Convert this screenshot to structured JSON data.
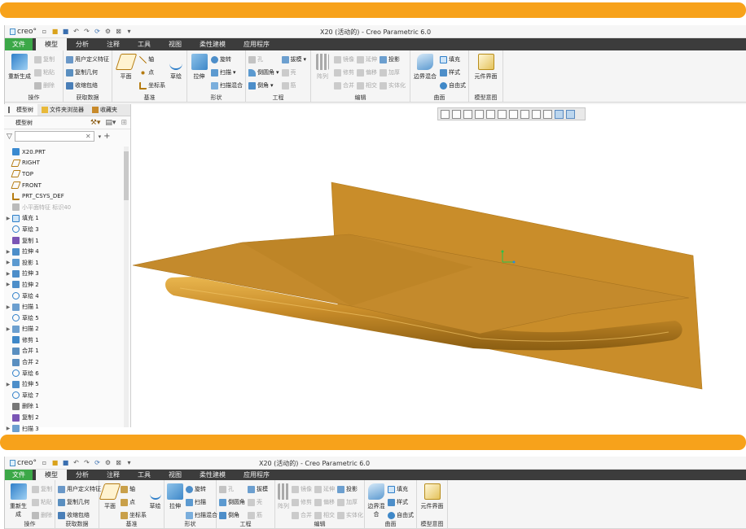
{
  "window": {
    "logo": "creo°",
    "title": "X20 (活动的) - Creo Parametric 6.0"
  },
  "menu": {
    "file": "文件",
    "tabs": [
      "模型",
      "分析",
      "注释",
      "工具",
      "视图",
      "柔性建模",
      "应用程序"
    ]
  },
  "ribbon": {
    "operations": {
      "label": "操作",
      "regen": "重新生成",
      "copy": "复制",
      "paste": "粘贴",
      "delete": "删除"
    },
    "get_data": {
      "label": "获取数据",
      "udf": "用户定义特征",
      "copy_geom": "复制几何",
      "shrinkwrap": "收缩包络"
    },
    "datum": {
      "label": "基准",
      "plane": "平面",
      "axis": "轴",
      "point": "点",
      "csys": "坐标系",
      "sketch": "草绘"
    },
    "shapes": {
      "label": "形状",
      "extrude": "拉伸",
      "revolve": "旋转",
      "sweep": "扫描",
      "swept_blend": "扫描混合"
    },
    "engineering": {
      "label": "工程",
      "hole": "孔",
      "round": "倒圆角",
      "chamfer": "倒角",
      "draft": "拔模",
      "shell": "壳",
      "rib": "筋"
    },
    "editing": {
      "label": "编辑",
      "pattern": "阵列",
      "mirror": "镜像",
      "extend": "延伸",
      "project": "投影",
      "trim": "修剪",
      "offset": "偏移",
      "thicken": "加厚",
      "merge": "合并",
      "intersect": "相交",
      "solidify": "实体化"
    },
    "surfaces": {
      "label": "曲面",
      "boundary_blend": "边界混合",
      "fill": "填充",
      "style": "样式",
      "freestyle": "自由式"
    },
    "model_intent": {
      "label": "模型意图",
      "component_interface": "元件界面"
    }
  },
  "left_panel": {
    "tabs": [
      "模型树",
      "文件夹浏览器",
      "收藏夹"
    ],
    "header": "模型树",
    "filter_placeholder": "",
    "tree": [
      {
        "label": "X20.PRT",
        "icon": "part-icon",
        "expand": ""
      },
      {
        "label": "RIGHT",
        "icon": "datum-plane-icon",
        "expand": ""
      },
      {
        "label": "TOP",
        "icon": "datum-plane-icon",
        "expand": ""
      },
      {
        "label": "FRONT",
        "icon": "datum-plane-icon",
        "expand": ""
      },
      {
        "label": "PRT_CSYS_DEF",
        "icon": "csys-icon",
        "expand": ""
      },
      {
        "label": "小平面特征 标识40",
        "icon": "facet-icon",
        "expand": "",
        "dim": true
      },
      {
        "label": "填充 1",
        "icon": "fill-icon",
        "expand": "▶"
      },
      {
        "label": "草绘 3",
        "icon": "sketch-icon",
        "expand": ""
      },
      {
        "label": "复制 1",
        "icon": "copy-feature-icon",
        "expand": ""
      },
      {
        "label": "拉伸 4",
        "icon": "extrude-icon",
        "expand": "▶"
      },
      {
        "label": "投影 1",
        "icon": "project-icon",
        "expand": "▶"
      },
      {
        "label": "拉伸 3",
        "icon": "extrude-icon",
        "expand": "▶"
      },
      {
        "label": "拉伸 2",
        "icon": "extrude-icon",
        "expand": "▶"
      },
      {
        "label": "草绘 4",
        "icon": "sketch-icon",
        "expand": ""
      },
      {
        "label": "扫描 1",
        "icon": "sweep-icon",
        "expand": "▶"
      },
      {
        "label": "草绘 5",
        "icon": "sketch-icon",
        "expand": ""
      },
      {
        "label": "扫描 2",
        "icon": "sweep-icon",
        "expand": "▶"
      },
      {
        "label": "修剪 1",
        "icon": "trim-icon",
        "expand": ""
      },
      {
        "label": "合并 1",
        "icon": "merge-icon",
        "expand": ""
      },
      {
        "label": "合并 2",
        "icon": "merge-icon",
        "expand": ""
      },
      {
        "label": "草绘 6",
        "icon": "sketch-icon",
        "expand": ""
      },
      {
        "label": "拉伸 5",
        "icon": "extrude-icon",
        "expand": "▶"
      },
      {
        "label": "草绘 7",
        "icon": "sketch-icon",
        "expand": ""
      },
      {
        "label": "删除 1",
        "icon": "delete-feature-icon",
        "expand": ""
      },
      {
        "label": "复制 2",
        "icon": "copy-feature-icon",
        "expand": ""
      },
      {
        "label": "扫描 3",
        "icon": "sweep-icon",
        "expand": "▶"
      }
    ]
  },
  "colors": {
    "accent_orange": "#f7a21b",
    "file_tab_green": "#3ca848",
    "menubar_dark": "#3c3c3c",
    "model_gold": "#c98d2a",
    "model_shade": "#9a6a16"
  }
}
